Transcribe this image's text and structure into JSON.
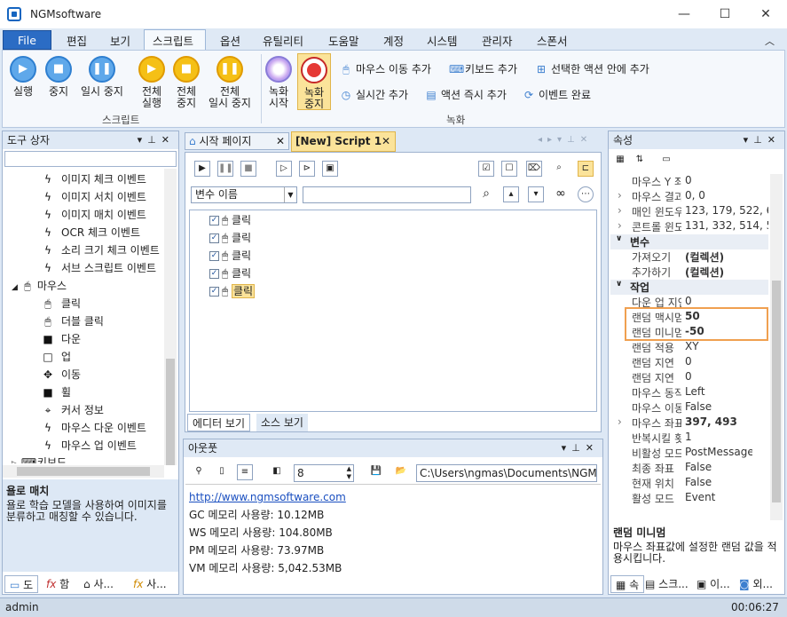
{
  "window": {
    "title": "NGMsoftware",
    "min": "—",
    "max": "☐",
    "close": "✕"
  },
  "menu": {
    "file": "File",
    "items": [
      "편집",
      "보기",
      "스크립트",
      "옵션",
      "유틸리티",
      "도움말",
      "계정",
      "시스템",
      "관리자",
      "스폰서"
    ]
  },
  "ribbon": {
    "run": "실행",
    "stop": "중지",
    "pause": "일시 중지",
    "all_run": [
      "전체",
      "실행"
    ],
    "all_stop": [
      "전체",
      "중지"
    ],
    "all_pause": [
      "전체",
      "일시 중지"
    ],
    "rec_start": [
      "녹화",
      "시작"
    ],
    "rec_stop": [
      "녹화",
      "중지"
    ],
    "mouse_move": "마우스 이동 추가",
    "keyboard": "키보드 추가",
    "selected_action": "선택한 액션 안에 추가",
    "realtime": "실시간 추가",
    "instant": "액션 즉시 추가",
    "event_done": "이벤트 완료",
    "group_script": "스크립트",
    "group_record": "녹화"
  },
  "toolbox": {
    "title": "도구 상자",
    "items": [
      "이미지 체크 이벤트",
      "이미지 서치 이벤트",
      "이미지 매치 이벤트",
      "OCR 체크 이벤트",
      "소리 크기 체크 이벤트",
      "서브 스크립트 이벤트"
    ],
    "mouse_group": "마우스",
    "mouse_items": [
      "클릭",
      "더블 클릭",
      "다운",
      "업",
      "이동",
      "휠",
      "커서 정보",
      "마우스 다운 이벤트",
      "마우스 업 이벤트"
    ],
    "keyboard_group": "키보드",
    "desc_title": "욜로 매치",
    "desc_text": "욜로 학습 모델을 사용하여 이미지를 분류하고 매칭할 수 있습니다.",
    "tabs": [
      "도",
      "함",
      "사...",
      "사..."
    ]
  },
  "editor": {
    "tab_start": "시작 페이지",
    "tab_script": "[New] Script 1",
    "var_select": "변수 이름",
    "actions": [
      "클릭",
      "클릭",
      "클릭",
      "클릭",
      "클릭"
    ],
    "tab_editor": "에디터 보기",
    "tab_source": "소스 보기"
  },
  "output": {
    "title": "아웃풋",
    "count": "8",
    "path": "C:\\Users\\ngmas\\Documents\\NGM6\\",
    "link": "http://www.ngmsoftware.com",
    "lines": [
      "GC 메모리 사용량: 10.12MB",
      "WS 메모리 사용량: 104.80MB",
      "PM 메모리 사용량: 73.97MB",
      "VM 메모리 사용량: 5,042.53MB"
    ]
  },
  "props": {
    "title": "속성",
    "rows_top": [
      {
        "k": "마우스 Y 좌표",
        "v": "0"
      },
      {
        "k": "마우스 결과",
        "v": "0, 0"
      },
      {
        "k": "매인 윈도우",
        "v": "123, 179, 522, 615"
      },
      {
        "k": "콘트롤 윈도우",
        "v": "131, 332, 514, 581"
      }
    ],
    "cat_var": "변수",
    "var_rows": [
      {
        "k": "가져오기",
        "v": "(컬렉션)"
      },
      {
        "k": "추가하기",
        "v": "(컬렉션)"
      }
    ],
    "cat_work": "작업",
    "work_rows": [
      {
        "k": "다운 업 지연",
        "v": "0"
      },
      {
        "k": "랜덤 맥시멈",
        "v": "50"
      },
      {
        "k": "랜덤 미니멈",
        "v": "-50"
      },
      {
        "k": "랜덤 적용",
        "v": "XY"
      },
      {
        "k": "랜덤 지연",
        "v": "0"
      },
      {
        "k": "랜덤 지연",
        "v": "0"
      },
      {
        "k": "마우스 동작",
        "v": "Left"
      },
      {
        "k": "마우스 이동",
        "v": "False"
      },
      {
        "k": "마우스 좌표",
        "v": "397, 493"
      },
      {
        "k": "반복시킬 횟수",
        "v": "1"
      },
      {
        "k": "비활성 모드",
        "v": "PostMessage"
      },
      {
        "k": "최종 좌표",
        "v": "False"
      },
      {
        "k": "현재 위치",
        "v": "False"
      },
      {
        "k": "활성 모드",
        "v": "Event"
      }
    ],
    "desc_title": "랜덤 미니멈",
    "desc_text": "마우스 좌표값에 설정한 랜덤 값을 적용시킵니다.",
    "tabs": [
      "속",
      "스크...",
      "이...",
      "외..."
    ]
  },
  "status": {
    "user": "admin",
    "time": "00:06:27"
  }
}
